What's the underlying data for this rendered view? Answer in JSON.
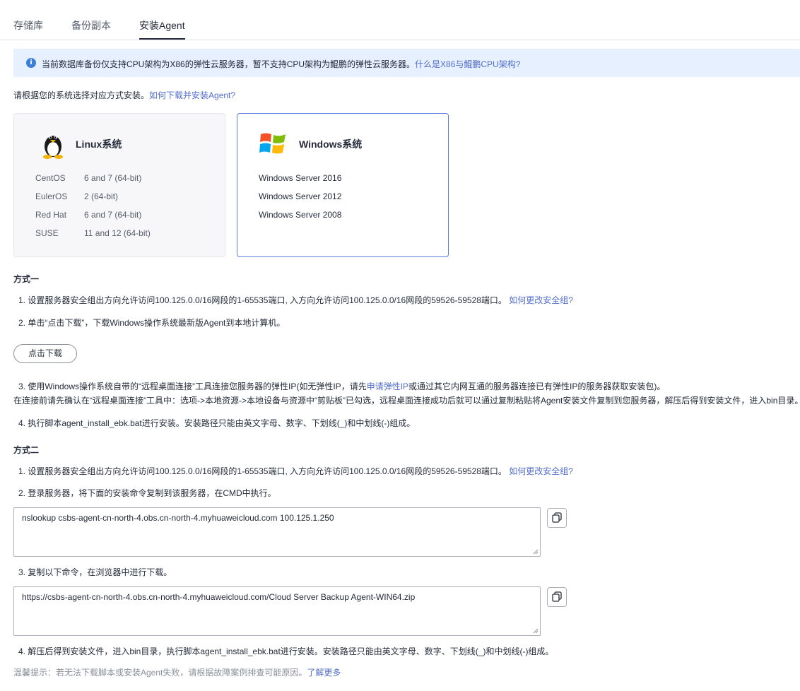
{
  "tabs": [
    {
      "label": "存储库"
    },
    {
      "label": "备份副本"
    },
    {
      "label": "安装Agent",
      "active": true
    }
  ],
  "alert": {
    "icon": "info-icon",
    "text": "当前数据库备份仅支持CPU架构为X86的弹性云服务器，暂不支持CPU架构为鲲鹏的弹性云服务器。",
    "link": "什么是X86与鲲鹏CPU架构?"
  },
  "intro": {
    "text": "请根据您的系统选择对应方式安装。",
    "link": "如何下载并安装Agent?"
  },
  "os_cards": {
    "linux": {
      "title": "Linux系统",
      "icon": "linux-penguin-icon",
      "rows": [
        {
          "name": "CentOS",
          "ver": "6 and 7 (64-bit)"
        },
        {
          "name": "EulerOS",
          "ver": "2 (64-bit)"
        },
        {
          "name": "Red Hat",
          "ver": "6 and 7 (64-bit)"
        },
        {
          "name": "SUSE",
          "ver": "11 and 12 (64-bit)"
        }
      ]
    },
    "windows": {
      "title": "Windows系统",
      "icon": "windows-logo-icon",
      "selected": true,
      "rows": [
        "Windows Server 2016",
        "Windows Server 2012",
        "Windows Server 2008"
      ]
    }
  },
  "method1": {
    "title": "方式一",
    "step1": {
      "text": "1.  设置服务器安全组出方向允许访问100.125.0.0/16网段的1-65535端口, 入方向允许访问100.125.0.0/16网段的59526-59528端口。",
      "link": "如何更改安全组?"
    },
    "step2": "2.  单击“点击下载”，下载Windows操作系统最新版Agent到本地计算机。",
    "download_button": "点击下载",
    "step3": {
      "pre": "3.   使用Windows操作系统自带的“远程桌面连接”工具连接您服务器的弹性IP(如无弹性IP，请先",
      "link": "申请弹性IP",
      "post": "或通过其它内网互通的服务器连接已有弹性IP的服务器获取安装包)。",
      "line2": "在连接前请先确认在“远程桌面连接”工具中：选项->本地资源->本地设备与资源中“剪贴板”已勾选，远程桌面连接成功后就可以通过复制粘贴将Agent安装文件复制到您服务器，解压后得到安装文件，进入bin目录。"
    },
    "step4": "4.  执行脚本agent_install_ebk.bat进行安装。安装路径只能由英文字母、数字、下划线(_)和中划线(-)组成。"
  },
  "method2": {
    "title": "方式二",
    "step1": {
      "text": "1.  设置服务器安全组出方向允许访问100.125.0.0/16网段的1-65535端口, 入方向允许访问100.125.0.0/16网段的59526-59528端口。",
      "link": "如何更改安全组?"
    },
    "step2": "2.  登录服务器，将下面的安装命令复制到该服务器，在CMD中执行。",
    "command1": "nslookup csbs-agent-cn-north-4.obs.cn-north-4.myhuaweicloud.com 100.125.1.250",
    "step3": "3.  复制以下命令，在浏览器中进行下载。",
    "command2": "https://csbs-agent-cn-north-4.obs.cn-north-4.myhuaweicloud.com/Cloud Server Backup Agent-WIN64.zip",
    "step4": "4.  解压后得到安装文件，进入bin目录，执行脚本agent_install_ebk.bat进行安装。安装路径只能由英文字母、数字、下划线(_)和中划线(-)组成。"
  },
  "tip": {
    "text": "温馨提示：若无法下载脚本或安装Agent失败，请根据故障案例排查可能原因。",
    "link": "了解更多"
  }
}
